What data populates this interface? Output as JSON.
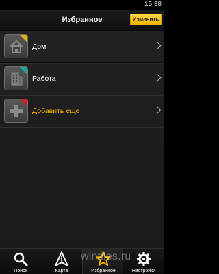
{
  "status_bar": {
    "time": "15:38"
  },
  "header": {
    "title": "Избранное",
    "edit_label": "Изменить"
  },
  "list": {
    "items": [
      {
        "label": "Дом",
        "icon": "home-icon",
        "corner_color": "#e6b100"
      },
      {
        "label": "Работа",
        "icon": "building-icon",
        "corner_color": "#1aa7a0"
      },
      {
        "label": "Добавить еще",
        "icon": "plus-icon",
        "corner_color": "#d21c2a"
      }
    ]
  },
  "tabs": [
    {
      "label": "Поиск",
      "icon": "search-icon"
    },
    {
      "label": "Карта",
      "icon": "navigation-arrow-icon"
    },
    {
      "label": "Избранное",
      "icon": "star-icon",
      "active": true
    },
    {
      "label": "Настройки",
      "icon": "gear-icon"
    }
  ],
  "watermark": "wintiles.ru",
  "colors": {
    "accent": "#f5b400",
    "background": "#1f1f1f"
  }
}
